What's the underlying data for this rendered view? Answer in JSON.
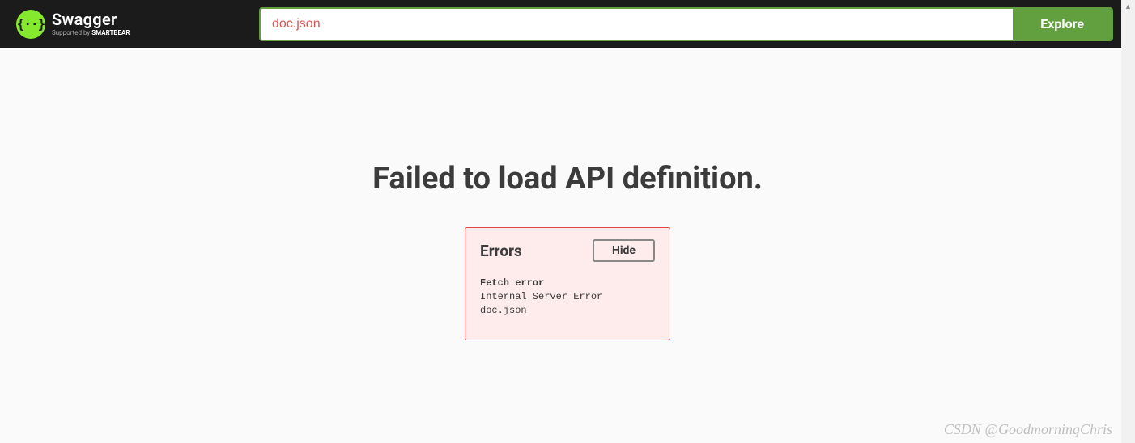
{
  "header": {
    "logo_glyph": "{··}",
    "logo_title": "Swagger",
    "logo_sub_prefix": "Supported by ",
    "logo_sub_brand": "SMARTBEAR",
    "url_value": "doc.json",
    "explore_label": "Explore"
  },
  "main": {
    "fail_title": "Failed to load API definition.",
    "errors_title": "Errors",
    "hide_label": "Hide",
    "error_heading": "Fetch error",
    "error_detail": "Internal Server Error doc.json"
  },
  "watermark": "CSDN @GoodmorningChris"
}
